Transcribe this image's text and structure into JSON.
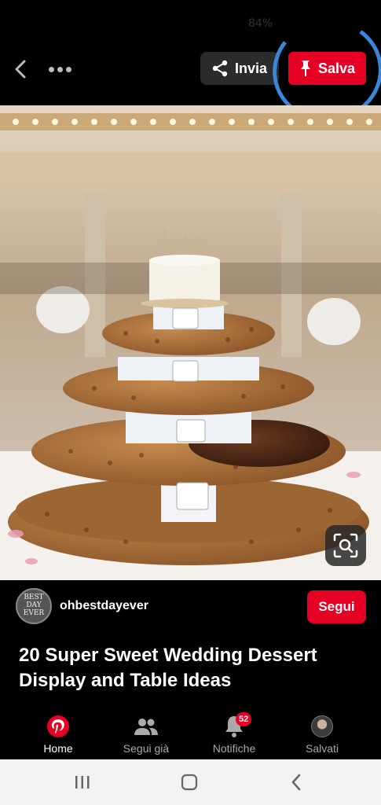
{
  "status_bar": {
    "battery": "84%"
  },
  "toolbar": {
    "share_label": "Invia",
    "save_label": "Salva"
  },
  "image": {
    "overlay_text": "love"
  },
  "creator": {
    "name": "ohbestdayever",
    "avatar_text": "BEST DAY EVER",
    "follow_label": "Segui"
  },
  "pin": {
    "title": "20 Super Sweet Wedding Dessert Display and Table Ideas"
  },
  "bottom_nav": {
    "items": [
      {
        "label": "Home",
        "icon": "pinterest-logo-icon",
        "active": true
      },
      {
        "label": "Segui già",
        "icon": "people-icon",
        "active": false
      },
      {
        "label": "Notifiche",
        "icon": "bell-icon",
        "active": false,
        "badge": "52"
      },
      {
        "label": "Salvati",
        "icon": "profile-avatar-icon",
        "active": false
      }
    ]
  },
  "colors": {
    "brand_red": "#e60023",
    "annotation_blue": "#3a86d8"
  }
}
